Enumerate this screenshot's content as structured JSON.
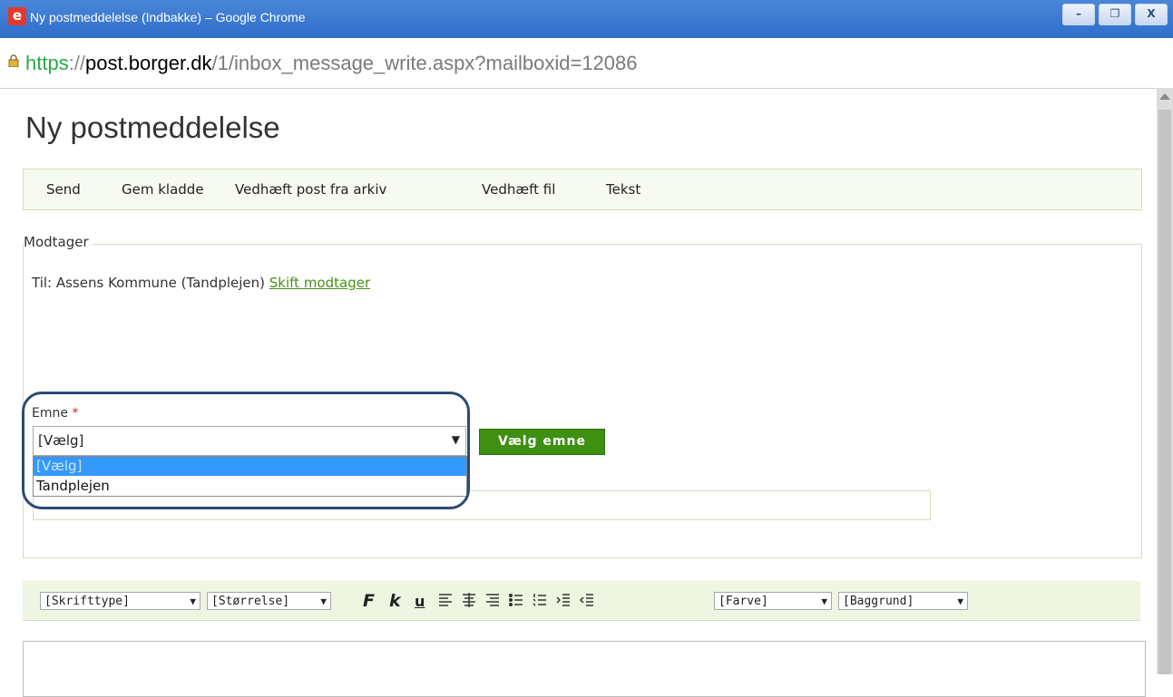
{
  "window": {
    "title": "Ny postmeddelelse (Indbakke) – Google Chrome",
    "app_icon_letter": "e",
    "buttons": [
      "–",
      "❐",
      "X"
    ]
  },
  "address": {
    "scheme": "https",
    "sep": "://",
    "host": "post.borger.dk",
    "path": "/1/inbox_message_write.aspx?mailboxid=12086"
  },
  "page": {
    "title": "Ny postmeddelelse"
  },
  "toolbar": {
    "send": "Send",
    "gem": "Gem kladde",
    "vedhaeft_post": "Vedhæft post fra arkiv",
    "vedhaeft_fil": "Vedhæft fil",
    "tekst": "Tekst"
  },
  "recipient": {
    "legend": "Modtager",
    "til": "Til: Assens Kommune (Tandplejen)",
    "skift": "Skift modtager"
  },
  "subject": {
    "label": "Emne",
    "required": "*",
    "selected": "[Vælg]",
    "options": [
      "[Vælg]",
      "Tandplejen"
    ],
    "choose_button": "Vælg emne"
  },
  "format": {
    "font": "[Skrifttype]",
    "size": "[Størrelse]",
    "bold": "F",
    "italic": "k",
    "underline": "u",
    "color": "[Farve]",
    "background": "[Baggrund]",
    "dropdown_arrow": "▼"
  },
  "colors": {
    "accent": "#3f8f12",
    "selection": "#3399ff",
    "highlight_border": "#2e4a76"
  }
}
